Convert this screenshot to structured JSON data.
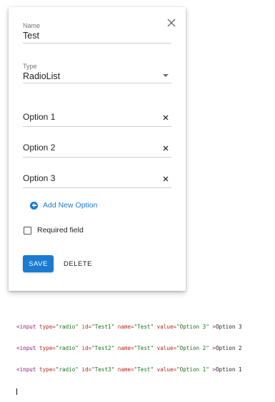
{
  "form": {
    "name_label": "Name",
    "name_value": "Test",
    "type_label": "Type",
    "type_value": "RadioList",
    "options": [
      {
        "value": "Option 1"
      },
      {
        "value": "Option 2"
      },
      {
        "value": "Option 3"
      }
    ],
    "add_option_label": "Add New Option",
    "required_label": "Required field",
    "required_checked": false,
    "save_label": "SAVE",
    "delete_label": "DELETE"
  },
  "code_lines": [
    {
      "type": "\"radio\"",
      "id": "\"Test1\"",
      "name": "\"Test\"",
      "value": "\"Option 3\"",
      "text": "Option 3"
    },
    {
      "type": "\"radio\"",
      "id": "\"Test2\"",
      "name": "\"Test\"",
      "value": "\"Option 2\"",
      "text": "Option 2"
    },
    {
      "type": "\"radio\"",
      "id": "\"Test3\"",
      "name": "\"Test\"",
      "value": "\"Option 1\"",
      "text": "Option 1"
    }
  ],
  "colors": {
    "accent": "#1a7bd1",
    "code_tag": "#8a1e7a",
    "code_attr": "#b5291c",
    "code_value": "#1b6e1b"
  },
  "icons": {
    "close": "close-icon",
    "remove": "clear-icon",
    "add": "add-circle-icon",
    "dropdown": "arrow-drop-down-icon"
  }
}
